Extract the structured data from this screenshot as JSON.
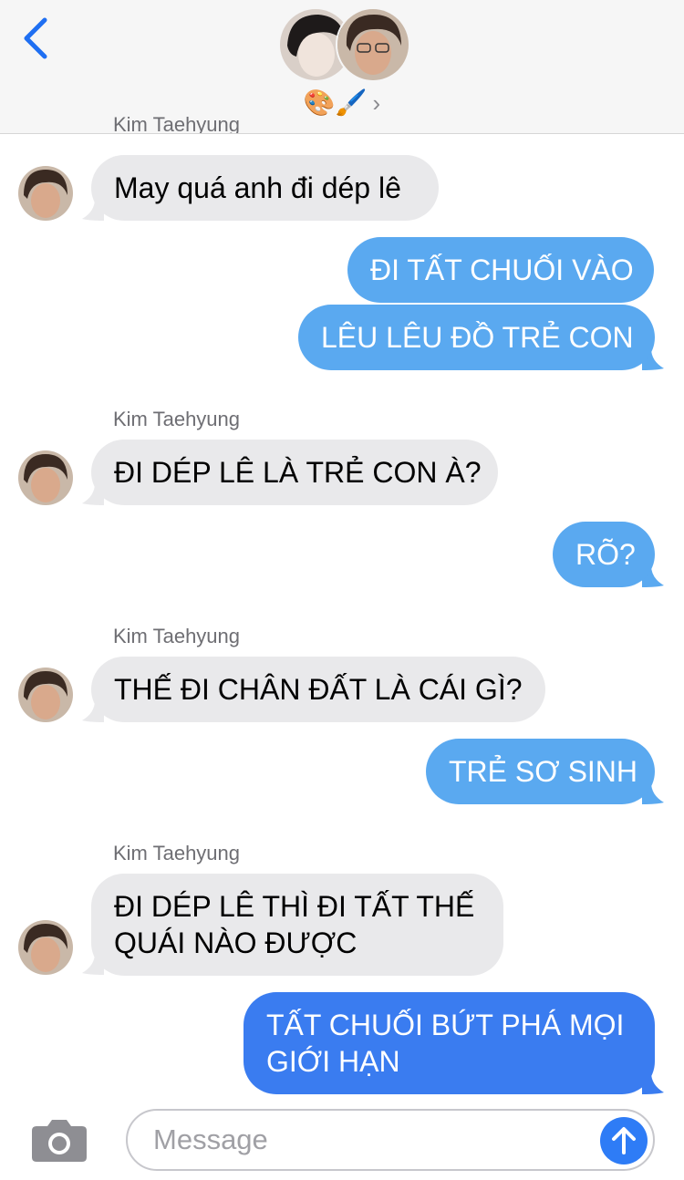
{
  "header": {
    "group_name": "🎨🖌️",
    "chevron": "›",
    "icons": [
      "back-chevron-icon",
      "avatar-jungkook",
      "avatar-taehyung"
    ],
    "bg_color": "#f6f6f6"
  },
  "thread": {
    "cut_sender": "Kim Taehyung",
    "messages": [
      {
        "kind": "in",
        "text": "May quá anh đi dép lê"
      },
      {
        "kind": "out",
        "text": "ĐI TẤT CHUỐI VÀO"
      },
      {
        "kind": "out",
        "text": "LÊU LÊU ĐỒ TRẺ CON"
      },
      {
        "kind": "sender",
        "text": "Kim Taehyung"
      },
      {
        "kind": "in",
        "text": "ĐI DÉP LÊ LÀ TRẺ CON À?"
      },
      {
        "kind": "out",
        "text": "RÕ?"
      },
      {
        "kind": "sender",
        "text": "Kim Taehyung"
      },
      {
        "kind": "in",
        "text": "THẾ ĐI CHÂN ĐẤT LÀ CÁI GÌ?"
      },
      {
        "kind": "out",
        "text": "TRẺ SƠ SINH"
      },
      {
        "kind": "sender",
        "text": "Kim Taehyung"
      },
      {
        "kind": "in",
        "lines": [
          "ĐI DÉP LÊ THÌ ĐI TẤT THẾ",
          "QUÁI NÀO ĐƯỢC"
        ]
      },
      {
        "kind": "out",
        "lines": [
          "TẤT CHUỐI BỨT PHÁ MỌI",
          "GIỚI HẠN"
        ]
      }
    ],
    "colors": {
      "incoming": "#e9e9eb",
      "outgoing": "#5aa9f0",
      "outgoing_last": "#3a7cf0"
    }
  },
  "composer": {
    "placeholder": "Message",
    "icons": [
      "camera-icon",
      "send-arrow-icon"
    ]
  }
}
